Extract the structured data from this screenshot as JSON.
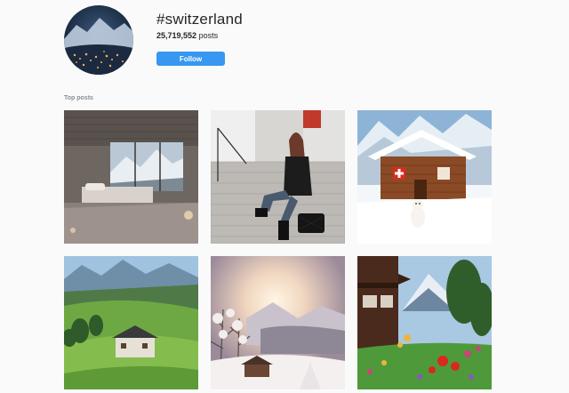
{
  "profile": {
    "hashtag": "#switzerland",
    "posts_count": "25,719,552",
    "posts_suffix": "posts",
    "follow_label": "Follow"
  },
  "top_posts": {
    "label": "Top posts",
    "items": [
      {
        "name": "post-modern-bedroom-mountain-view"
      },
      {
        "name": "post-woman-on-stairs"
      },
      {
        "name": "post-swiss-chalet-snow"
      },
      {
        "name": "post-green-valley-hut"
      },
      {
        "name": "post-snowy-sunset-valley"
      },
      {
        "name": "post-chalet-flower-garden"
      }
    ]
  },
  "colors": {
    "accent": "#3897f0",
    "background": "#fafafa",
    "label_gray": "#8e8e8e"
  }
}
